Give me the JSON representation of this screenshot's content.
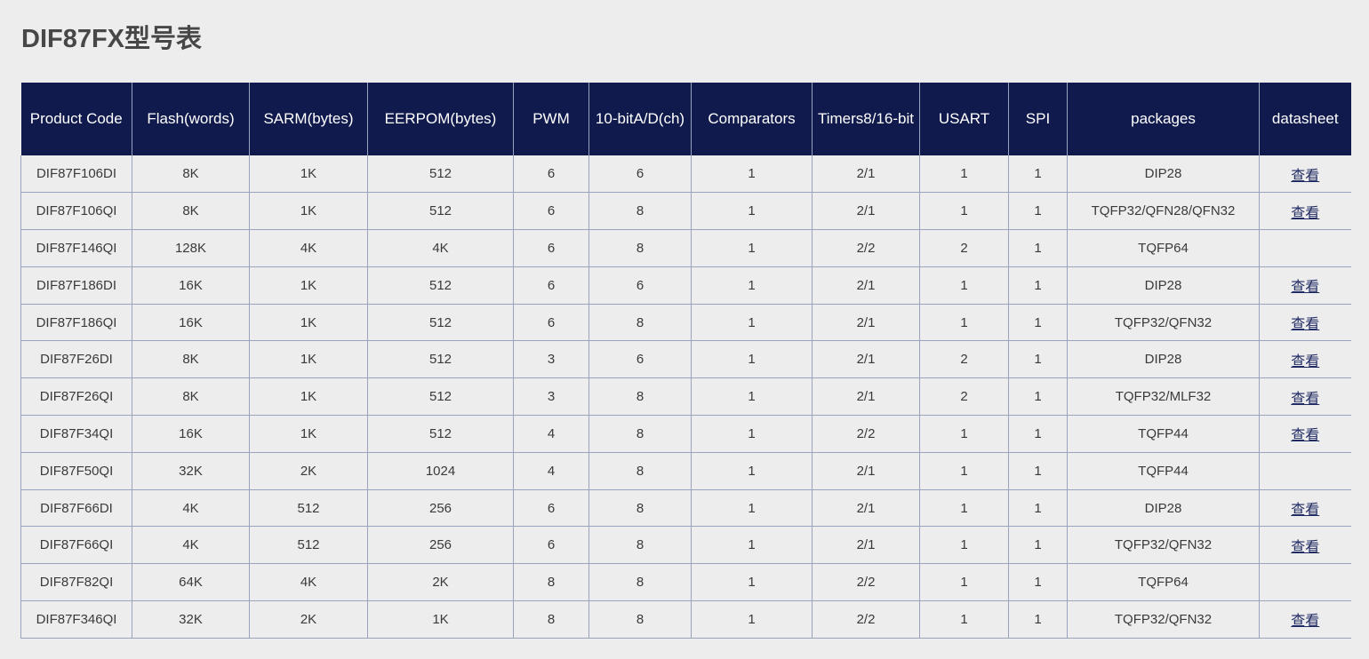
{
  "page": {
    "title": "DIF87FX型号表",
    "background_color": "#ededed",
    "header_color": "#111a4d",
    "header_text_color": "#ffffff",
    "link_color": "#202a63",
    "border_color": "#9aa3bd",
    "text_color": "#3a3a3a"
  },
  "table": {
    "columns": [
      {
        "key": "code",
        "label": "Product Code"
      },
      {
        "key": "flash",
        "label": "Flash(words)"
      },
      {
        "key": "sarm",
        "label": "SARM(bytes)"
      },
      {
        "key": "eerpom",
        "label": "EERPOM(bytes)"
      },
      {
        "key": "pwm",
        "label": "PWM"
      },
      {
        "key": "adc",
        "label": "10-bitA/D(ch)"
      },
      {
        "key": "comparators",
        "label": "Comparators"
      },
      {
        "key": "timers",
        "label": "Timers8/16-bit"
      },
      {
        "key": "usart",
        "label": "USART"
      },
      {
        "key": "spi",
        "label": "SPI"
      },
      {
        "key": "packages",
        "label": "packages"
      },
      {
        "key": "datasheet",
        "label": "datasheet"
      }
    ],
    "datasheet_link_label": "查看",
    "rows": [
      {
        "code": "DIF87F106DI",
        "flash": "8K",
        "sarm": "1K",
        "eerpom": "512",
        "pwm": "6",
        "adc": "6",
        "comparators": "1",
        "timers": "2/1",
        "usart": "1",
        "spi": "1",
        "packages": "DIP28",
        "datasheet": "查看"
      },
      {
        "code": "DIF87F106QI",
        "flash": "8K",
        "sarm": "1K",
        "eerpom": "512",
        "pwm": "6",
        "adc": "8",
        "comparators": "1",
        "timers": "2/1",
        "usart": "1",
        "spi": "1",
        "packages": "TQFP32/QFN28/QFN32",
        "datasheet": "查看"
      },
      {
        "code": "DIF87F146QI",
        "flash": "128K",
        "sarm": "4K",
        "eerpom": "4K",
        "pwm": "6",
        "adc": "8",
        "comparators": "1",
        "timers": "2/2",
        "usart": "2",
        "spi": "1",
        "packages": "TQFP64",
        "datasheet": ""
      },
      {
        "code": "DIF87F186DI",
        "flash": "16K",
        "sarm": "1K",
        "eerpom": "512",
        "pwm": "6",
        "adc": "6",
        "comparators": "1",
        "timers": "2/1",
        "usart": "1",
        "spi": "1",
        "packages": "DIP28",
        "datasheet": "查看"
      },
      {
        "code": "DIF87F186QI",
        "flash": "16K",
        "sarm": "1K",
        "eerpom": "512",
        "pwm": "6",
        "adc": "8",
        "comparators": "1",
        "timers": "2/1",
        "usart": "1",
        "spi": "1",
        "packages": "TQFP32/QFN32",
        "datasheet": "查看"
      },
      {
        "code": "DIF87F26DI",
        "flash": "8K",
        "sarm": "1K",
        "eerpom": "512",
        "pwm": "3",
        "adc": "6",
        "comparators": "1",
        "timers": "2/1",
        "usart": "2",
        "spi": "1",
        "packages": "DIP28",
        "datasheet": "查看"
      },
      {
        "code": "DIF87F26QI",
        "flash": "8K",
        "sarm": "1K",
        "eerpom": "512",
        "pwm": "3",
        "adc": "8",
        "comparators": "1",
        "timers": "2/1",
        "usart": "2",
        "spi": "1",
        "packages": "TQFP32/MLF32",
        "datasheet": "查看"
      },
      {
        "code": "DIF87F34QI",
        "flash": "16K",
        "sarm": "1K",
        "eerpom": "512",
        "pwm": "4",
        "adc": "8",
        "comparators": "1",
        "timers": "2/2",
        "usart": "1",
        "spi": "1",
        "packages": "TQFP44",
        "datasheet": "查看"
      },
      {
        "code": "DIF87F50QI",
        "flash": "32K",
        "sarm": "2K",
        "eerpom": "1024",
        "pwm": "4",
        "adc": "8",
        "comparators": "1",
        "timers": "2/1",
        "usart": "1",
        "spi": "1",
        "packages": "TQFP44",
        "datasheet": ""
      },
      {
        "code": "DIF87F66DI",
        "flash": "4K",
        "sarm": "512",
        "eerpom": "256",
        "pwm": "6",
        "adc": "8",
        "comparators": "1",
        "timers": "2/1",
        "usart": "1",
        "spi": "1",
        "packages": "DIP28",
        "datasheet": "查看"
      },
      {
        "code": "DIF87F66QI",
        "flash": "4K",
        "sarm": "512",
        "eerpom": "256",
        "pwm": "6",
        "adc": "8",
        "comparators": "1",
        "timers": "2/1",
        "usart": "1",
        "spi": "1",
        "packages": "TQFP32/QFN32",
        "datasheet": "查看"
      },
      {
        "code": "DIF87F82QI",
        "flash": "64K",
        "sarm": "4K",
        "eerpom": "2K",
        "pwm": "8",
        "adc": "8",
        "comparators": "1",
        "timers": "2/2",
        "usart": "1",
        "spi": "1",
        "packages": "TQFP64",
        "datasheet": ""
      },
      {
        "code": "DIF87F346QI",
        "flash": "32K",
        "sarm": "2K",
        "eerpom": "1K",
        "pwm": "8",
        "adc": "8",
        "comparators": "1",
        "timers": "2/2",
        "usart": "1",
        "spi": "1",
        "packages": "TQFP32/QFN32",
        "datasheet": "查看"
      }
    ]
  }
}
